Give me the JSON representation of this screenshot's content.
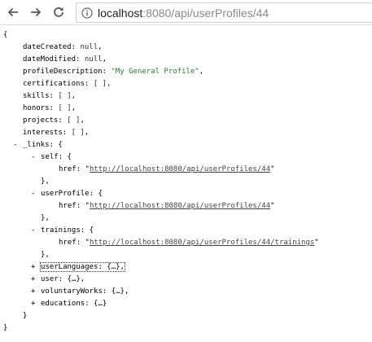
{
  "browser": {
    "url_host": "localhost",
    "url_path": ":8080/api/userProfiles/44"
  },
  "json": {
    "open_brace": "{",
    "close_brace": "}",
    "close_brace_comma": "},",
    "dateCreated": {
      "key": "dateCreated",
      "value": "null"
    },
    "dateModified": {
      "key": "dateModified",
      "value": "null"
    },
    "profileDescription": {
      "key": "profileDescription",
      "value": "\"My General Profile\""
    },
    "certifications": {
      "key": "certifications",
      "value": "[ ]"
    },
    "skills": {
      "key": "skills",
      "value": "[ ]"
    },
    "honors": {
      "key": "honors",
      "value": "[ ]"
    },
    "projects": {
      "key": "projects",
      "value": "[ ]"
    },
    "interests": {
      "key": "interests",
      "value": "[ ]"
    },
    "links_key": "_links",
    "self": {
      "toggle": "-",
      "key": "self",
      "href_key": "href",
      "href": "http://localhost:8080/api/userProfiles/44"
    },
    "userProfile": {
      "toggle": "-",
      "key": "userProfile",
      "href_key": "href",
      "href": "http://localhost:8080/api/userProfiles/44"
    },
    "trainings": {
      "toggle": "-",
      "key": "trainings",
      "href_key": "href",
      "href": "http://localhost:8080/api/userProfiles/44/trainings"
    },
    "collapsed": [
      {
        "toggle": "+",
        "key": "userLanguages",
        "value": "{…},"
      },
      {
        "toggle": "+",
        "key": "user",
        "value": "{…},"
      },
      {
        "toggle": "+",
        "key": "voluntaryWorks",
        "value": "{…},"
      },
      {
        "toggle": "+",
        "key": "educations",
        "value": "{…}"
      }
    ],
    "links_toggle": "-"
  }
}
